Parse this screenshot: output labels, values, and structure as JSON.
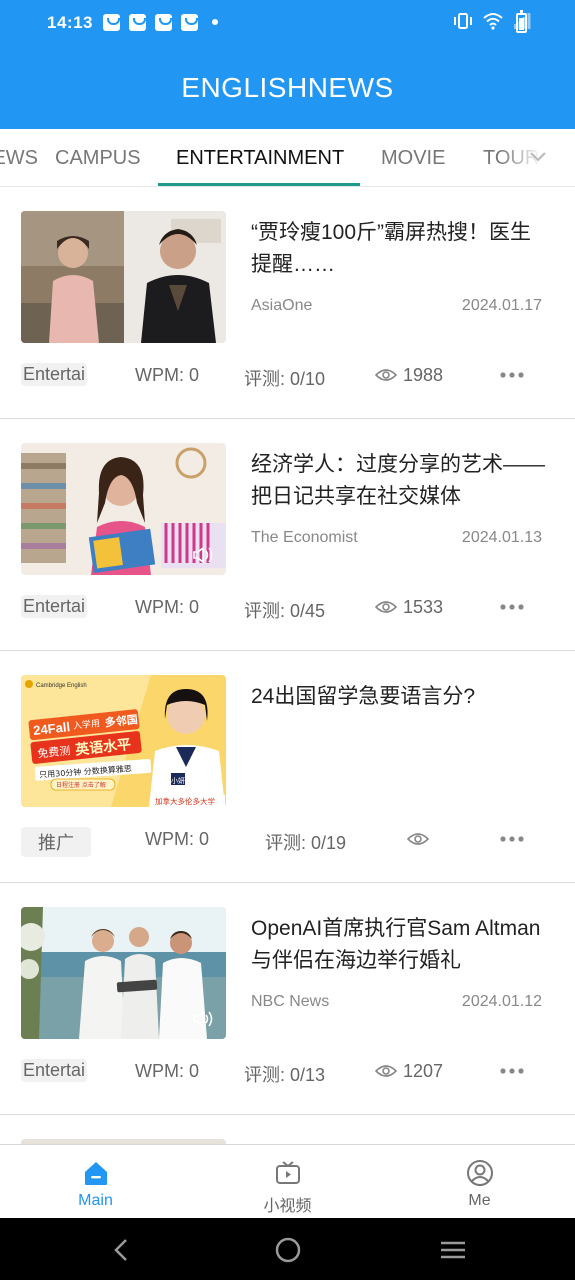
{
  "status": {
    "time": "14:13"
  },
  "app": {
    "title": "ENGLISHNEWS"
  },
  "tabs": [
    {
      "label": "NEWS"
    },
    {
      "label": "CAMPUS"
    },
    {
      "label": "ENTERTAINMENT",
      "active": true
    },
    {
      "label": "MOVIE"
    },
    {
      "label": "TOUR"
    }
  ],
  "articles": [
    {
      "title": "“贾玲瘦100斤”霸屏热搜！医生提醒……",
      "source": "AsiaOne",
      "date": "2024.01.17",
      "tag": "Entertai",
      "wpm": "WPM: 0",
      "score": "评测: 0/10",
      "views": "1988"
    },
    {
      "title": "经济学人：过度分享的艺术——把日记共享在社交媒体",
      "source": "The Economist",
      "date": "2024.01.13",
      "tag": "Entertai",
      "wpm": "WPM: 0",
      "score": "评测: 0/45",
      "views": "1533"
    },
    {
      "title": "24出国留学急要语言分?",
      "tag": "推广",
      "wpm": "WPM: 0",
      "score": "评测: 0/19",
      "ad": {
        "brand": "Cambridge English",
        "line1": "24Fall",
        "line1b": "入学用",
        "line1c": "多邻国",
        "line2": "免费测",
        "line2b": "英语水平",
        "line3": "只用30分钟 分数换算雅思",
        "line4": "日程注册 点击了解",
        "badge": "小妍",
        "school": "加拿大多伦多大学"
      }
    },
    {
      "title": "OpenAI首席执行官Sam Altman与伴侣在海边举行婚礼",
      "source": "NBC News",
      "date": "2024.01.12",
      "tag": "Entertai",
      "wpm": "WPM: 0",
      "score": "评测: 0/13",
      "views": "1207"
    }
  ],
  "nav": [
    {
      "label": "Main",
      "icon": "home-icon",
      "active": true
    },
    {
      "label": "小视频",
      "icon": "video-icon"
    },
    {
      "label": "Me",
      "icon": "profile-icon"
    }
  ],
  "colors": {
    "primary": "#2196f3",
    "tab_indicator": "#20998d"
  }
}
